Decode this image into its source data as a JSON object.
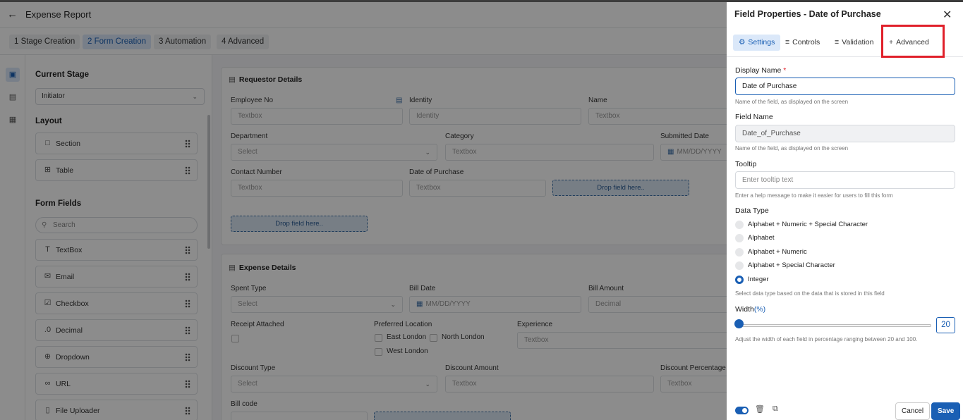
{
  "header": {
    "back_icon": "arrow-left-icon",
    "title": "Expense Report"
  },
  "stages": [
    {
      "label": "1  Stage Creation",
      "active": false
    },
    {
      "label": "2  Form Creation",
      "active": true
    },
    {
      "label": "3  Automation",
      "active": false
    },
    {
      "label": "4  Advanced",
      "active": false
    }
  ],
  "left_panel": {
    "current_stage_heading": "Current Stage",
    "current_stage_value": "Initiator",
    "layout_heading": "Layout",
    "layout_items": [
      "Section",
      "Table"
    ],
    "form_fields_heading": "Form Fields",
    "search_placeholder": "Search",
    "fields": [
      "TextBox",
      "Email",
      "Checkbox",
      "Decimal",
      "Dropdown",
      "URL",
      "File Uploader"
    ]
  },
  "requestor": {
    "title": "Requestor Details",
    "employee_no_label": "Employee No",
    "employee_no_ph": "Textbox",
    "identity_label": "Identity",
    "identity_ph": "Identity",
    "name_label": "Name",
    "name_ph": "Textbox",
    "department_label": "Department",
    "department_ph": "Select",
    "category_label": "Category",
    "category_ph": "Textbox",
    "submitted_label": "Submitted Date",
    "submitted_ph": "MM/DD/YYYY",
    "contact_label": "Contact Number",
    "contact_ph": "Textbox",
    "purchase_label": "Date of Purchase",
    "purchase_ph": "Textbox",
    "drop_text": "Drop field here.."
  },
  "expense": {
    "title": "Expense Details",
    "spent_label": "Spent Type",
    "spent_ph": "Select",
    "bill_date_label": "Bill Date",
    "bill_date_ph": "MM/DD/YYYY",
    "bill_amount_label": "Bill Amount",
    "bill_amount_ph": "Decimal",
    "receipt_label": "Receipt Attached",
    "location_label": "Preferred Location",
    "loc1": "East London",
    "loc2": "North London",
    "loc3": "West London",
    "experience_label": "Experience",
    "experience_ph": "Textbox",
    "discount_type_label": "Discount Type",
    "discount_type_ph": "Select",
    "discount_amount_label": "Discount Amount",
    "discount_amount_ph": "Textbox",
    "discount_pct_label": "Discount Percentage",
    "discount_pct_ph": "Textbox",
    "bill_code_label": "Bill code"
  },
  "properties": {
    "title": "Field Properties - Date of Purchase",
    "tabs": [
      "Settings",
      "Controls",
      "Validation",
      "Advanced"
    ],
    "display_name_label": "Display Name",
    "required_mark": "*",
    "display_name_value": "Date of Purchase",
    "display_help": "Name of the field, as displayed on the screen",
    "field_name_label": "Field Name",
    "field_name_value": "Date_of_Purchase",
    "field_help": "Name of the field, as displayed on the screen",
    "tooltip_label": "Tooltip",
    "tooltip_placeholder": "Enter tooltip text",
    "tooltip_help": "Enter a help message to make it easier for users to fill this form",
    "data_type_label": "Data Type",
    "data_types": [
      "Alphabet + Numeric + Special Character",
      "Alphabet",
      "Alphabet + Numeric",
      "Alphabet + Special Character",
      "Integer"
    ],
    "selected_data_type": "Integer",
    "data_type_help": "Select data type based on the data that is stored in this field",
    "width_label": "Width",
    "width_unit": "(%)",
    "width_value": "20",
    "width_help": "Adjust the width of each field in percentage ranging between 20 and 100.",
    "cancel": "Cancel",
    "save": "Save"
  },
  "colors": {
    "accent": "#1a5fb4",
    "highlight": "#e0202a"
  }
}
